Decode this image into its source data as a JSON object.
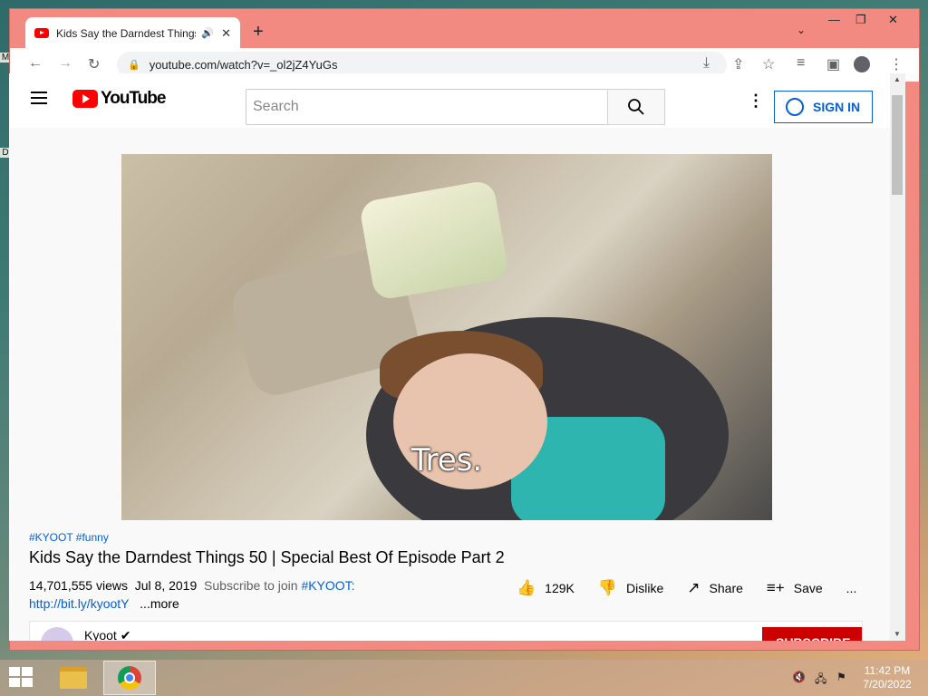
{
  "browser": {
    "tab_title": "Kids Say the Darndest Things",
    "tab_audio": "🔊",
    "tab_close": "✕",
    "new_tab": "+",
    "url": "youtube.com/watch?v=_ol2jZ4YuGs",
    "window_controls": [
      "—",
      "❐",
      "✕"
    ]
  },
  "desktop": {
    "fragments": [
      "M",
      "D"
    ]
  },
  "youtube": {
    "logo_text": "YouTube",
    "search_placeholder": "Search",
    "sign_in": "SIGN IN",
    "video_caption": "Tres.",
    "tags": "#KYOOT #funny",
    "title": "Kids Say the Darndest Things 50 | Special Best Of Episode Part 2",
    "views": "14,701,555 views",
    "date": "Jul 8, 2019",
    "desc_prefix": "Subscribe to join",
    "desc_hashtag": "#KYOOT:",
    "desc_link": "http://bit.ly/kyootY",
    "more": "...more",
    "likes": "129K",
    "dislike": "Dislike",
    "share": "Share",
    "save": "Save",
    "more_actions": "...",
    "channel": "Kyoot",
    "subscribe": "SUBSCRIBE"
  },
  "taskbar": {
    "time": "11:42 PM",
    "date": "7/20/2022"
  }
}
